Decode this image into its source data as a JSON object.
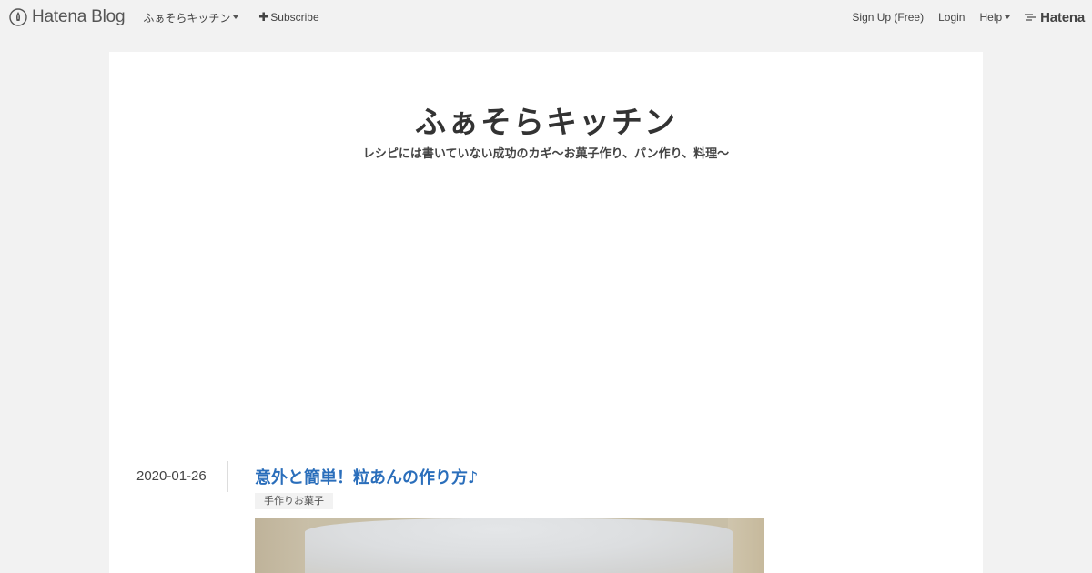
{
  "topbar": {
    "brand": "Hatena Blog",
    "blog_menu_label": "ふぁそらキッチン",
    "subscribe_label": "Subscribe",
    "signup_label": "Sign Up (Free)",
    "login_label": "Login",
    "help_label": "Help",
    "hatena_label": "Hatena"
  },
  "blog": {
    "title": "ふぁそらキッチン",
    "description": "レシピには書いていない成功のカギ～お菓子作り、パン作り、料理～"
  },
  "entry": {
    "date": "2020-01-26",
    "title": "意外と簡単！粒あんの作り方♪",
    "category": "手作りお菓子"
  },
  "icons": {
    "brand": "pen-icon",
    "subscribe": "plus-icon",
    "hatena": "hatena-mark-icon",
    "dropdown": "caret-down-icon"
  },
  "colors": {
    "background": "#f2f2f2",
    "panel": "#ffffff",
    "entry_title": "#2a6ebb",
    "text": "#333333"
  }
}
